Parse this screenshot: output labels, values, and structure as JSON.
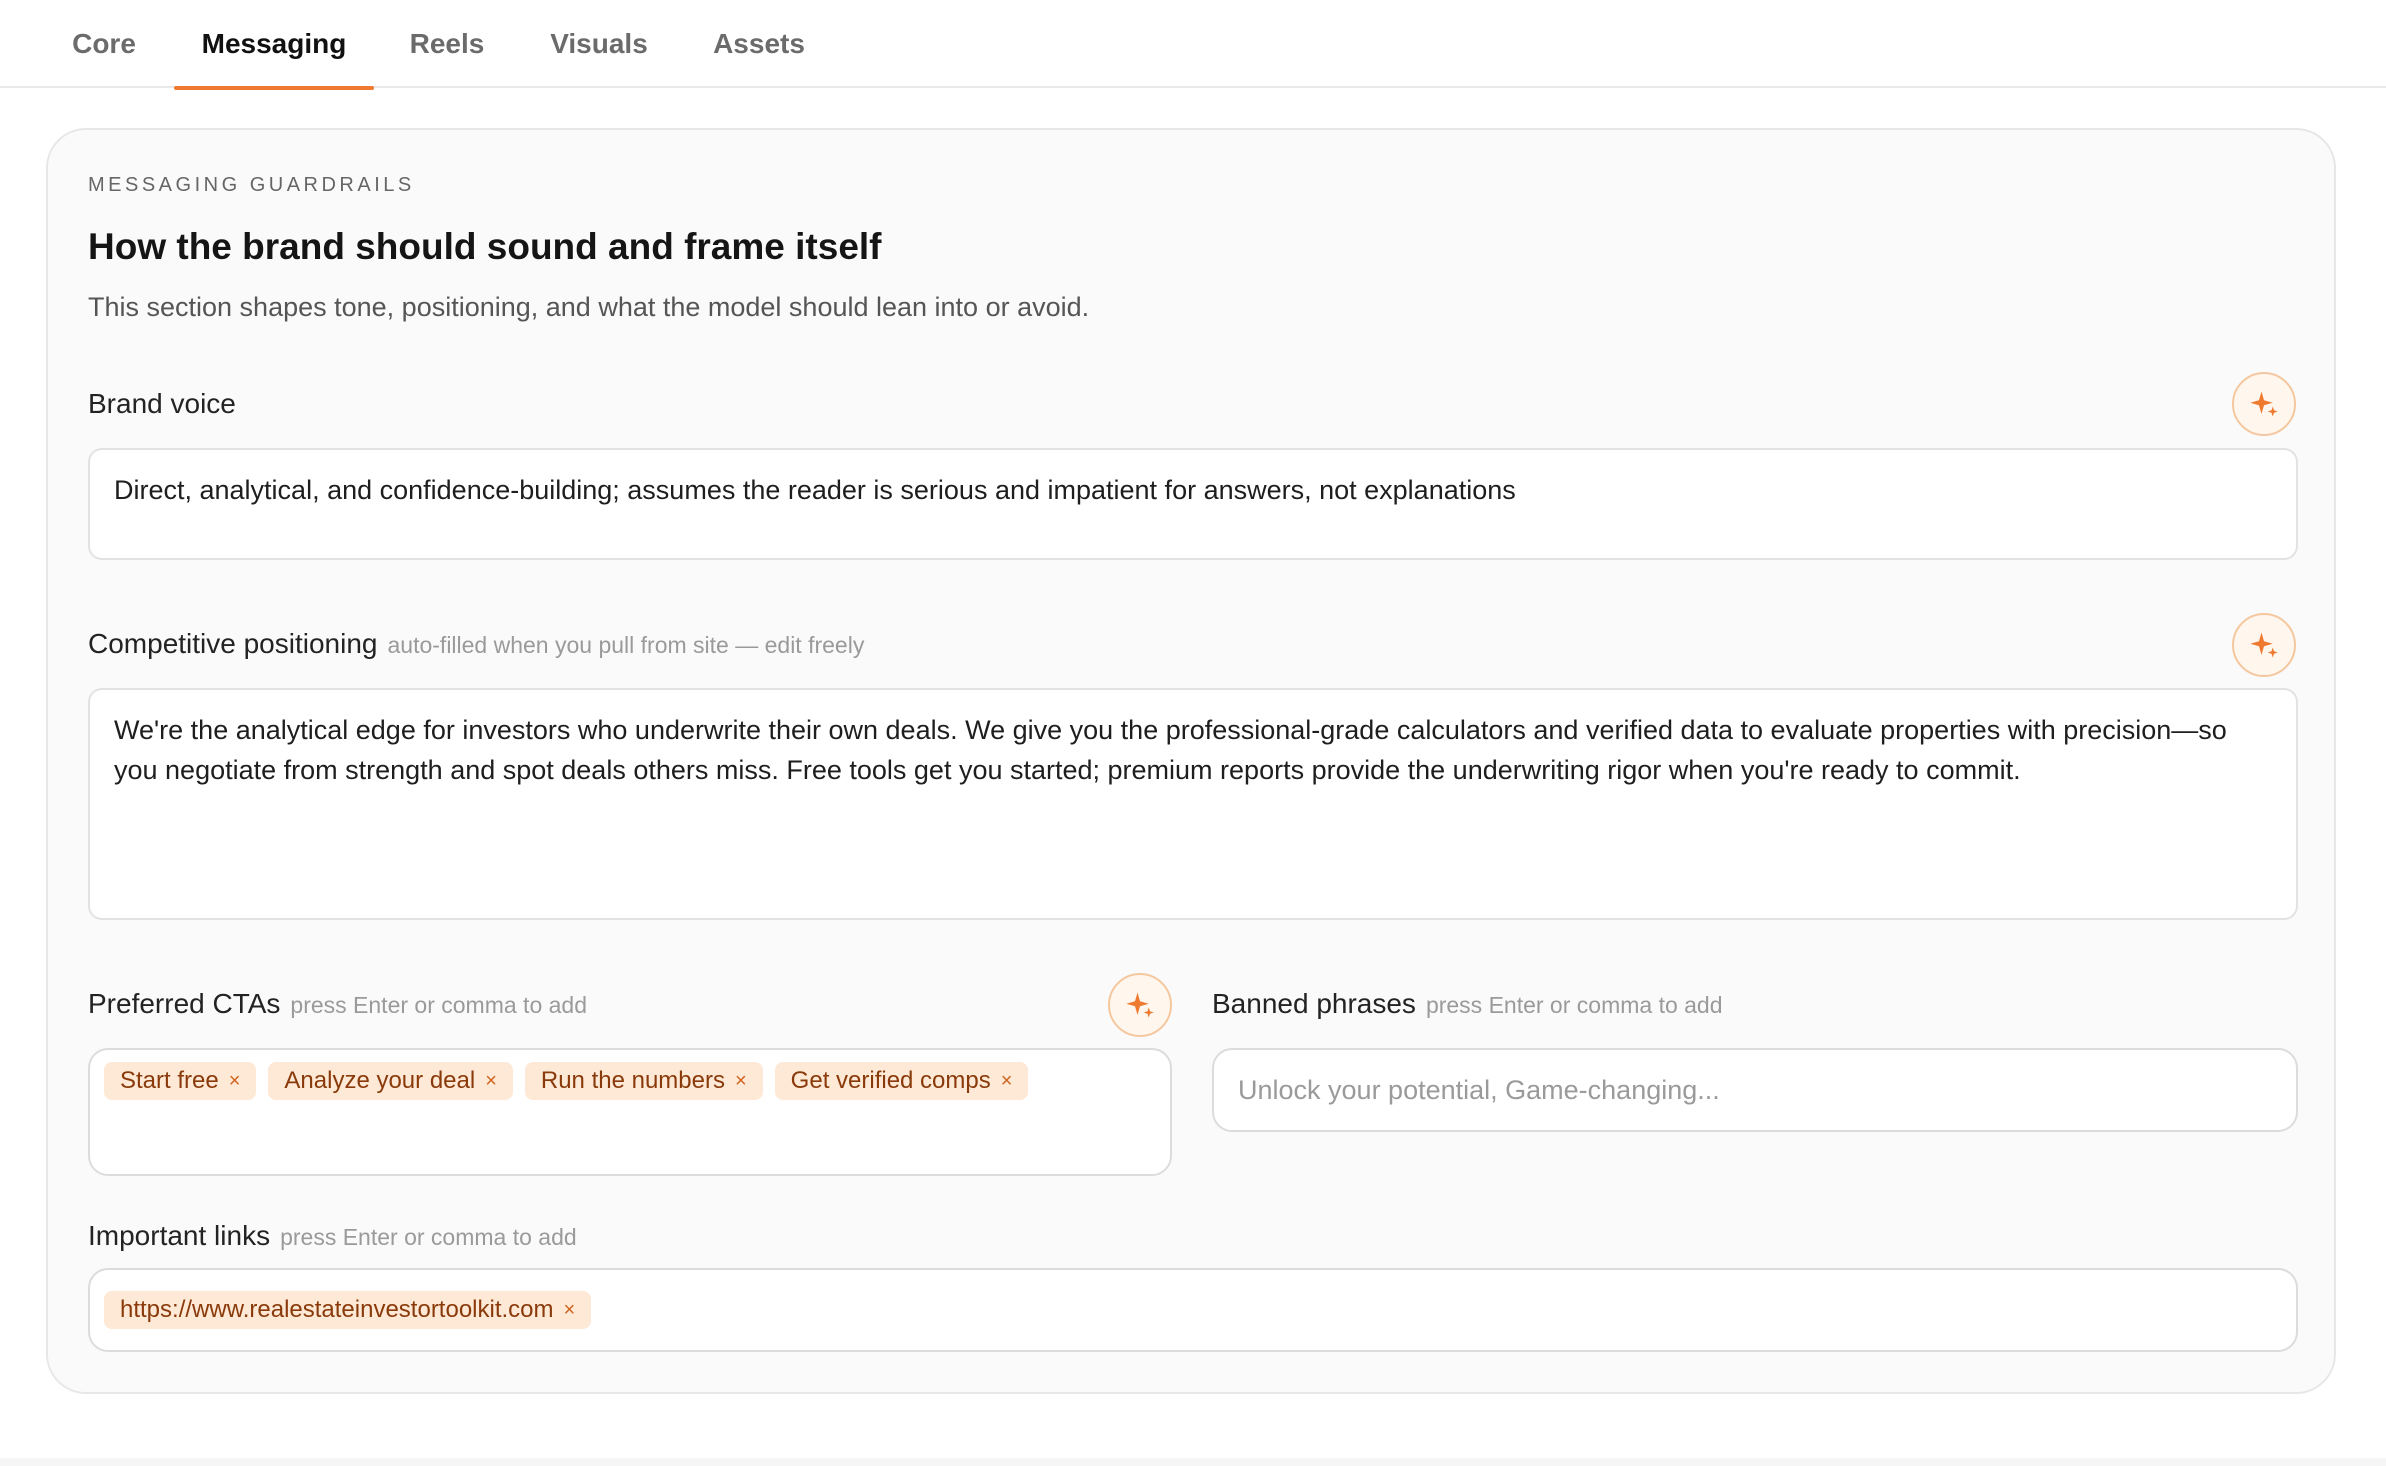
{
  "tabs": [
    {
      "label": "Core",
      "active": false
    },
    {
      "label": "Messaging",
      "active": true
    },
    {
      "label": "Reels",
      "active": false
    },
    {
      "label": "Visuals",
      "active": false
    },
    {
      "label": "Assets",
      "active": false
    }
  ],
  "section": {
    "eyebrow": "MESSAGING GUARDRAILS",
    "title": "How the brand should sound and frame itself",
    "description": "This section shapes tone, positioning, and what the model should lean into or avoid."
  },
  "brand_voice": {
    "label": "Brand voice",
    "value": "Direct, analytical, and confidence-building; assumes the reader is serious and impatient for answers, not explanations"
  },
  "competitive_positioning": {
    "label": "Competitive positioning",
    "hint": "auto-filled when you pull from site — edit freely",
    "value": "We're the analytical edge for investors who underwrite their own deals. We give you the professional-grade calculators and verified data to evaluate properties with precision—so you negotiate from strength and spot deals others miss. Free tools get you started; premium reports provide the underwriting rigor when you're ready to commit."
  },
  "preferred_ctas": {
    "label": "Preferred CTAs",
    "hint": "press Enter or comma to add",
    "chips": [
      "Start free",
      "Analyze your deal",
      "Run the numbers",
      "Get verified comps"
    ],
    "remove_glyph": "×"
  },
  "banned_phrases": {
    "label": "Banned phrases",
    "hint": "press Enter or comma to add",
    "placeholder": "Unlock your potential, Game-changing..."
  },
  "important_links": {
    "label": "Important links",
    "hint": "press Enter or comma to add",
    "chips": [
      "https://www.realestateinvestortoolkit.com"
    ],
    "remove_glyph": "×"
  },
  "colors": {
    "accent": "#ee7a2f",
    "chip_bg": "#fde9d6",
    "chip_text": "#8a3a0a"
  },
  "icons": {
    "ai_assist": "sparkle-icon",
    "chip_remove": "close-icon"
  }
}
